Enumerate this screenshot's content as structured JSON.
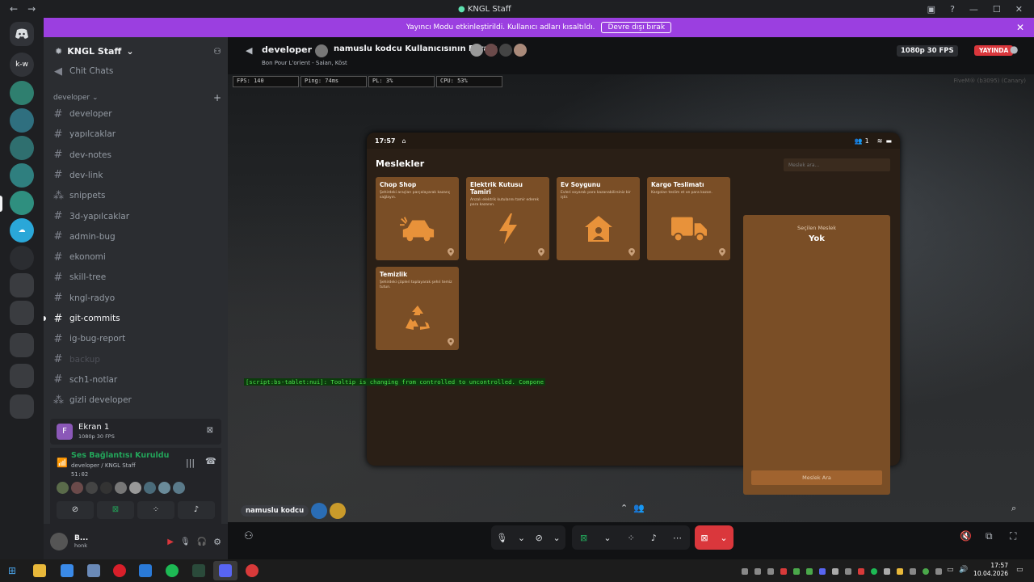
{
  "window": {
    "title": "KNGL Staff"
  },
  "banner": {
    "text": "Yayıncı Modu etkinleştirildi. Kullanıcı adları kısaltıldı.",
    "button": "Devre dışı bırak"
  },
  "guilds": [
    {
      "label": "k-w",
      "color": "#313338"
    }
  ],
  "sidebar": {
    "server_name": "KNGL Staff",
    "top_channel": "Chit Chats",
    "category": "developer",
    "channels": [
      {
        "name": "developer",
        "type": "text"
      },
      {
        "name": "yapılcaklar",
        "type": "text"
      },
      {
        "name": "dev-notes",
        "type": "text"
      },
      {
        "name": "dev-link",
        "type": "text"
      },
      {
        "name": "snippets",
        "type": "forum"
      },
      {
        "name": "3d-yapılcaklar",
        "type": "text"
      },
      {
        "name": "admin-bug",
        "type": "text"
      },
      {
        "name": "ekonomi",
        "type": "text"
      },
      {
        "name": "skill-tree",
        "type": "text"
      },
      {
        "name": "kngl-radyo",
        "type": "text"
      },
      {
        "name": "git-commits",
        "type": "text",
        "active": true
      },
      {
        "name": "ig-bug-report",
        "type": "text"
      },
      {
        "name": "backup",
        "type": "text",
        "muted": true
      },
      {
        "name": "sch1-notlar",
        "type": "text"
      },
      {
        "name": "gizli developer",
        "type": "forum"
      }
    ]
  },
  "screenshare": {
    "label": "Ekran 1",
    "quality": "1080p 30 FPS"
  },
  "voice": {
    "status": "Ses Bağlantısı Kuruldu",
    "location": "developer / KNGL Staff",
    "timer": "51:02"
  },
  "user": {
    "name": "B...",
    "activity": "honk"
  },
  "stream_header": {
    "channel": "developer",
    "title": "namuslu kodcu Kullanıcısının Ekranı",
    "subtitle": "Bon Pour L'orient - Saian, Köst",
    "quality": "1080p 30 FPS",
    "live": "YAYINDA"
  },
  "stats": [
    "FPS: 140",
    "Ping: 74ms",
    "PL: 3%",
    "CPU: 53%"
  ],
  "game_watermark": "FiveM® (b3095) (Canary)",
  "tablet": {
    "time": "17:57",
    "users": "1",
    "heading": "Meslekler",
    "search_placeholder": "Meslek ara...",
    "jobs": [
      {
        "title": "Chop Shop",
        "desc": "Şehirdeki araçları parçalayarak kazanç sağlayın.",
        "icon": "car-crash-icon"
      },
      {
        "title": "Elektrik Kutusu Tamiri",
        "desc": "Arızalı elektrik kutularını tamir ederek para kazanın.",
        "icon": "bolt-icon"
      },
      {
        "title": "Ev Soygunu",
        "desc": "Evleri soyarak para kazanabilirsiniz bir iştir.",
        "icon": "house-user-icon"
      },
      {
        "title": "Kargo Teslimatı",
        "desc": "Kargoları teslim et ve para kazan.",
        "icon": "truck-icon"
      },
      {
        "title": "Temizlik",
        "desc": "Şehirdeki çöpleri toplayarak şehri temiz tutun.",
        "icon": "recycle-icon"
      }
    ],
    "selected_label": "Seçilen Meslek",
    "selected_value": "Yok",
    "action_button": "Meslek Ara"
  },
  "console_line": "[script:bs-tablet:nui]: Tooltip is changing from controlled to uncontrolled. Compone",
  "stream_user_tag": "namuslu kodcu",
  "taskbar": {
    "time": "17:57",
    "date": "10.04.2026"
  },
  "colors": {
    "accent": "#9b3fe0",
    "card": "#7a4e26",
    "tablet_bg": "#2a1f16",
    "live": "#da373c",
    "button": "#a0632f",
    "icon": "#e8923a"
  }
}
